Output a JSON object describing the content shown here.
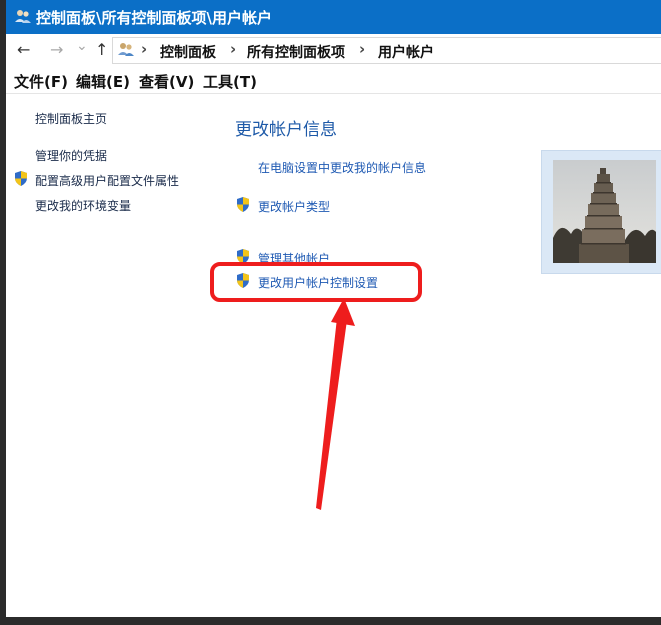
{
  "window": {
    "title": "控制面板\\所有控制面板项\\用户帐户"
  },
  "nav": {
    "back": "←",
    "forward": "→",
    "recent": "⌄",
    "up": "↑",
    "breadcrumbs": [
      "控制面板",
      "所有控制面板项",
      "用户帐户"
    ],
    "separator": "›"
  },
  "menubar": {
    "items": [
      "文件(F)",
      "编辑(E)",
      "查看(V)",
      "工具(T)"
    ]
  },
  "sidebar": {
    "items": [
      {
        "label": "控制面板主页",
        "icon": null
      },
      {
        "label": "管理你的凭据",
        "icon": null
      },
      {
        "label": "配置高级用户配置文件属性",
        "icon": "uac-shield-icon"
      },
      {
        "label": "更改我的环境变量",
        "icon": null
      }
    ]
  },
  "main": {
    "title": "更改帐户信息",
    "links": [
      {
        "label": "在电脑设置中更改我的帐户信息",
        "icon": null
      },
      {
        "label": "更改帐户类型",
        "icon": "uac-shield-icon"
      },
      {
        "label": "管理其他帐户",
        "icon": "uac-shield-icon"
      },
      {
        "label": "更改用户帐户控制设置",
        "icon": "uac-shield-icon"
      }
    ]
  },
  "colors": {
    "titlebar": "#0b6fc7",
    "link": "#1f5ab3",
    "annotation": "#ee1d1d"
  }
}
